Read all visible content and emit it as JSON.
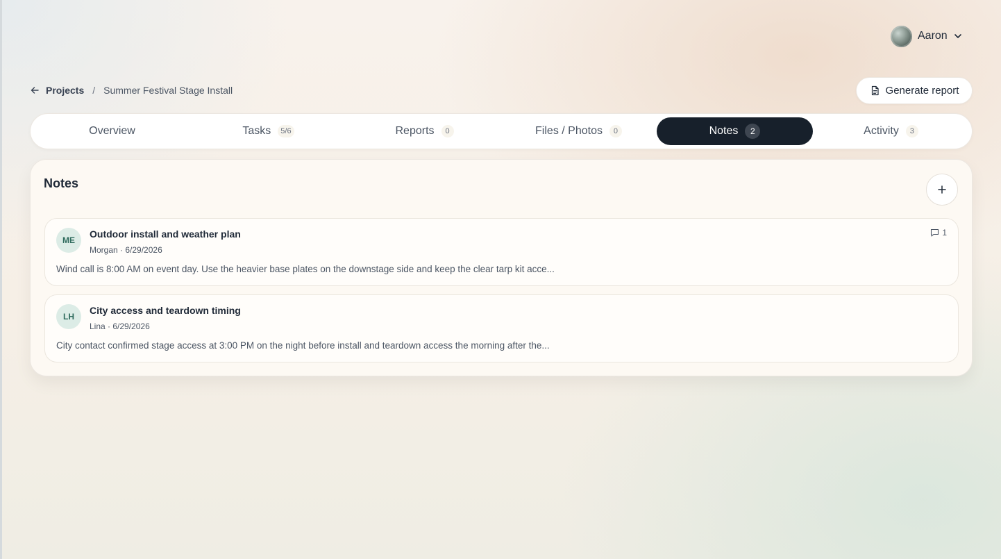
{
  "user": {
    "name": "Aaron"
  },
  "breadcrumb": {
    "parent": "Projects",
    "separator": "/",
    "current": "Summer Festival Stage Install"
  },
  "actions": {
    "generate_report": "Generate report"
  },
  "tabs": [
    {
      "label": "Overview",
      "count": ""
    },
    {
      "label": "Tasks",
      "count": "5/6"
    },
    {
      "label": "Reports",
      "count": "0"
    },
    {
      "label": "Files / Photos",
      "count": "0"
    },
    {
      "label": "Notes",
      "count": "2",
      "active": true
    },
    {
      "label": "Activity",
      "count": "3"
    }
  ],
  "notes_panel": {
    "title": "Notes",
    "notes": [
      {
        "initials": "ME",
        "title": "Outdoor install and weather plan",
        "meta": "Morgan · 6/29/2026",
        "body": "Wind call is 8:00 AM on event day. Use the heavier base plates on the downstage side and keep the clear tarp kit acce...",
        "comments": "1"
      },
      {
        "initials": "LH",
        "title": "City access and teardown timing",
        "meta": "Lina · 6/29/2026",
        "body": "City contact confirmed stage access at 3:00 PM on the night before install and teardown access the morning after the...",
        "comments": ""
      }
    ]
  },
  "colors": {
    "active_tab": "#17202b",
    "initials_bg": "#dcece6",
    "initials_text": "#2f6b5d"
  },
  "icons": {
    "back": "arrow-left-icon",
    "report": "document-icon",
    "add": "plus-icon",
    "comment": "comment-icon",
    "menu": "chevron-down-icon"
  }
}
